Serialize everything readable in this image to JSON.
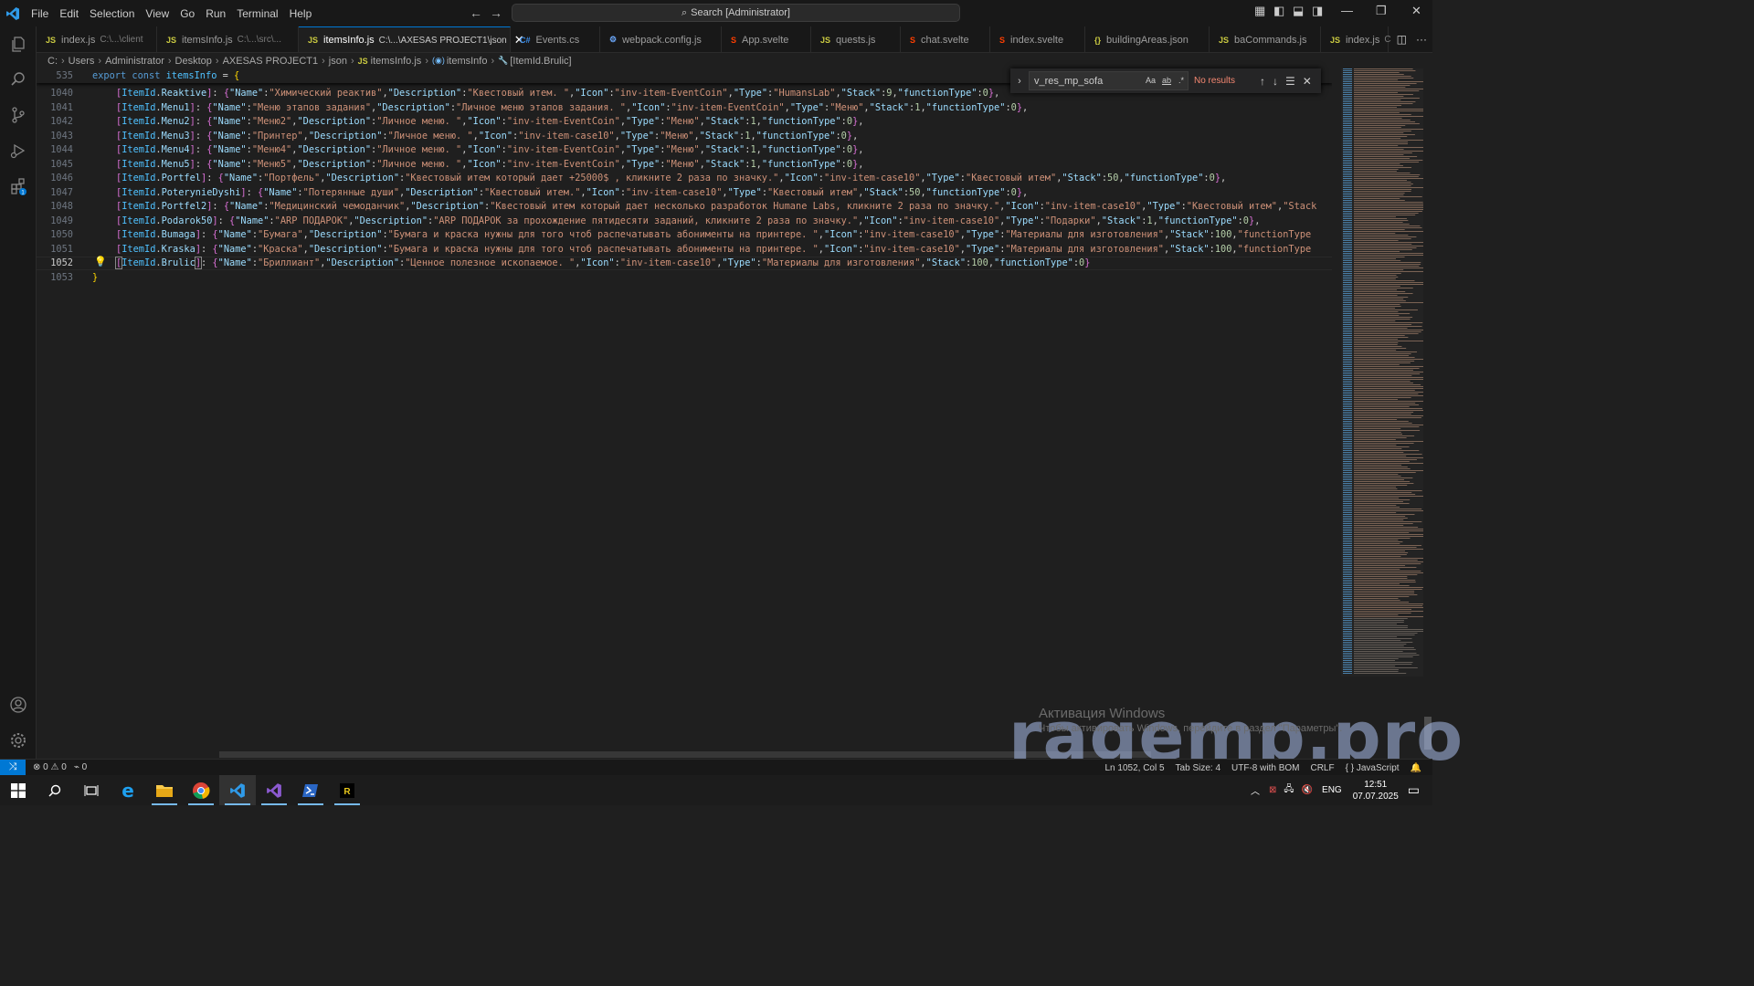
{
  "menu": [
    "File",
    "Edit",
    "Selection",
    "View",
    "Go",
    "Run",
    "Terminal",
    "Help"
  ],
  "search": {
    "label": "Search [Administrator]"
  },
  "tabs": [
    {
      "icon": "JS",
      "name": "index.js",
      "path": "C:\\...\\client"
    },
    {
      "icon": "JS",
      "name": "itemsInfo.js",
      "path": "C:\\...\\src\\..."
    },
    {
      "icon": "JS",
      "name": "itemsInfo.js",
      "path": "C:\\...\\AXESAS PROJECT1\\json",
      "active": true
    },
    {
      "icon": "C#",
      "name": "Events.cs",
      "path": ""
    },
    {
      "icon": "⚙",
      "name": "webpack.config.js",
      "path": ""
    },
    {
      "icon": "S",
      "name": "App.svelte",
      "path": ""
    },
    {
      "icon": "JS",
      "name": "quests.js",
      "path": ""
    },
    {
      "icon": "S",
      "name": "chat.svelte",
      "path": ""
    },
    {
      "icon": "S",
      "name": "index.svelte",
      "path": ""
    },
    {
      "icon": "{}",
      "name": "buildingAreas.json",
      "path": ""
    },
    {
      "icon": "JS",
      "name": "baCommands.js",
      "path": ""
    },
    {
      "icon": "JS",
      "name": "index.js",
      "path": "C"
    }
  ],
  "breadcrumb": [
    "C:",
    "Users",
    "Administrator",
    "Desktop",
    "AXESAS PROJECT1",
    "json",
    "itemsInfo.js",
    "itemsInfo",
    "[ItemId.Brulic]"
  ],
  "find": {
    "query": "v_res_mp_sofa",
    "result": "No results",
    "opt_case": "Aa",
    "opt_word": "ab",
    "opt_regex": ".*"
  },
  "sticky": {
    "num": "535",
    "code": "export const itemsInfo = {"
  },
  "lines": [
    {
      "num": "1040",
      "key": "Reaktive",
      "rest": ": {\"Name\":\"Химический реактив\",\"Description\":\"Квестовый итем. \",\"Icon\":\"inv-item-EventCoin\",\"Type\":\"HumansLab\",\"Stack\":9,\"functionType\":0},"
    },
    {
      "num": "1041",
      "key": "Menu1",
      "rest": ": {\"Name\":\"Меню этапов задания\",\"Description\":\"Личное меню этапов задания. \",\"Icon\":\"inv-item-EventCoin\",\"Type\":\"Меню\",\"Stack\":1,\"functionType\":0},"
    },
    {
      "num": "1042",
      "key": "Menu2",
      "rest": ": {\"Name\":\"Меню2\",\"Description\":\"Личное меню. \",\"Icon\":\"inv-item-EventCoin\",\"Type\":\"Меню\",\"Stack\":1,\"functionType\":0},"
    },
    {
      "num": "1043",
      "key": "Menu3",
      "rest": ": {\"Name\":\"Принтер\",\"Description\":\"Личное меню. \",\"Icon\":\"inv-item-case10\",\"Type\":\"Меню\",\"Stack\":1,\"functionType\":0},"
    },
    {
      "num": "1044",
      "key": "Menu4",
      "rest": ": {\"Name\":\"Меню4\",\"Description\":\"Личное меню. \",\"Icon\":\"inv-item-EventCoin\",\"Type\":\"Меню\",\"Stack\":1,\"functionType\":0},"
    },
    {
      "num": "1045",
      "key": "Menu5",
      "rest": ": {\"Name\":\"Меню5\",\"Description\":\"Личное меню. \",\"Icon\":\"inv-item-EventCoin\",\"Type\":\"Меню\",\"Stack\":1,\"functionType\":0},"
    },
    {
      "num": "1046",
      "key": "Portfel",
      "rest": ": {\"Name\":\"Портфель\",\"Description\":\"Квестовый итем который дает +25000$ , кликните 2 раза по значку.\",\"Icon\":\"inv-item-case10\",\"Type\":\"Квестовый итем\",\"Stack\":50,\"functionType\":0},"
    },
    {
      "num": "1047",
      "key": "PoterynieDyshi",
      "rest": ": {\"Name\":\"Потерянные души\",\"Description\":\"Квестовый итем.\",\"Icon\":\"inv-item-case10\",\"Type\":\"Квестовый итем\",\"Stack\":50,\"functionType\":0},"
    },
    {
      "num": "1048",
      "key": "Portfel2",
      "rest": ": {\"Name\":\"Медицинский чемоданчик\",\"Description\":\"Квестовый итем который дает несколько разработок Humane Labs, кликните 2 раза по значку.\",\"Icon\":\"inv-item-case10\",\"Type\":\"Квестовый итем\",\"Stack"
    },
    {
      "num": "1049",
      "key": "Podarok50",
      "rest": ": {\"Name\":\"ARP ПОДАРОК\",\"Description\":\"ARP ПОДАРОК за прохождение пятидесяти заданий, кликните 2 раза по значку.\",\"Icon\":\"inv-item-case10\",\"Type\":\"Подарки\",\"Stack\":1,\"functionType\":0},"
    },
    {
      "num": "1050",
      "key": "Bumaga",
      "rest": ": {\"Name\":\"Бумага\",\"Description\":\"Бумага и краска нужны для того чтоб распечатывать абонименты на принтере. \",\"Icon\":\"inv-item-case10\",\"Type\":\"Материалы для изготовления\",\"Stack\":100,\"functionType"
    },
    {
      "num": "1051",
      "key": "Kraska",
      "rest": ": {\"Name\":\"Краска\",\"Description\":\"Бумага и краска нужны для того чтоб распечатывать абонименты на принтере. \",\"Icon\":\"inv-item-case10\",\"Type\":\"Материалы для изготовления\",\"Stack\":100,\"functionType"
    },
    {
      "num": "1052",
      "key": "Brulic",
      "rest": ": {\"Name\":\"Бриллиант\",\"Description\":\"Ценное полезное ископаемое. \",\"Icon\":\"inv-item-case10\",\"Type\":\"Материалы для изготовления\",\"Stack\":100,\"functionType\":0}",
      "current": true
    },
    {
      "num": "1053",
      "key": "",
      "rest": "}"
    }
  ],
  "line_prefix": "ItemId.",
  "status": {
    "errors": "0",
    "warnings": "0",
    "ports": "0",
    "position": "Ln 1052, Col 5",
    "tabsize": "Tab Size: 4",
    "encoding": "UTF-8 with BOM",
    "eol": "CRLF",
    "language": "JavaScript"
  },
  "watermark": {
    "title": "Активация Windows",
    "subtitle": "Чтобы активировать Windows, перейдите в раздел \"Параметры\".",
    "site": "ragemp.pro"
  },
  "taskbar": {
    "lang": "ENG",
    "time": "12:51",
    "date": "07.07.2025"
  },
  "colors": {
    "accent": "#0078d4",
    "editor_bg": "#1f1f1f",
    "chrome_bg": "#181818",
    "no_results": "#f48771"
  }
}
